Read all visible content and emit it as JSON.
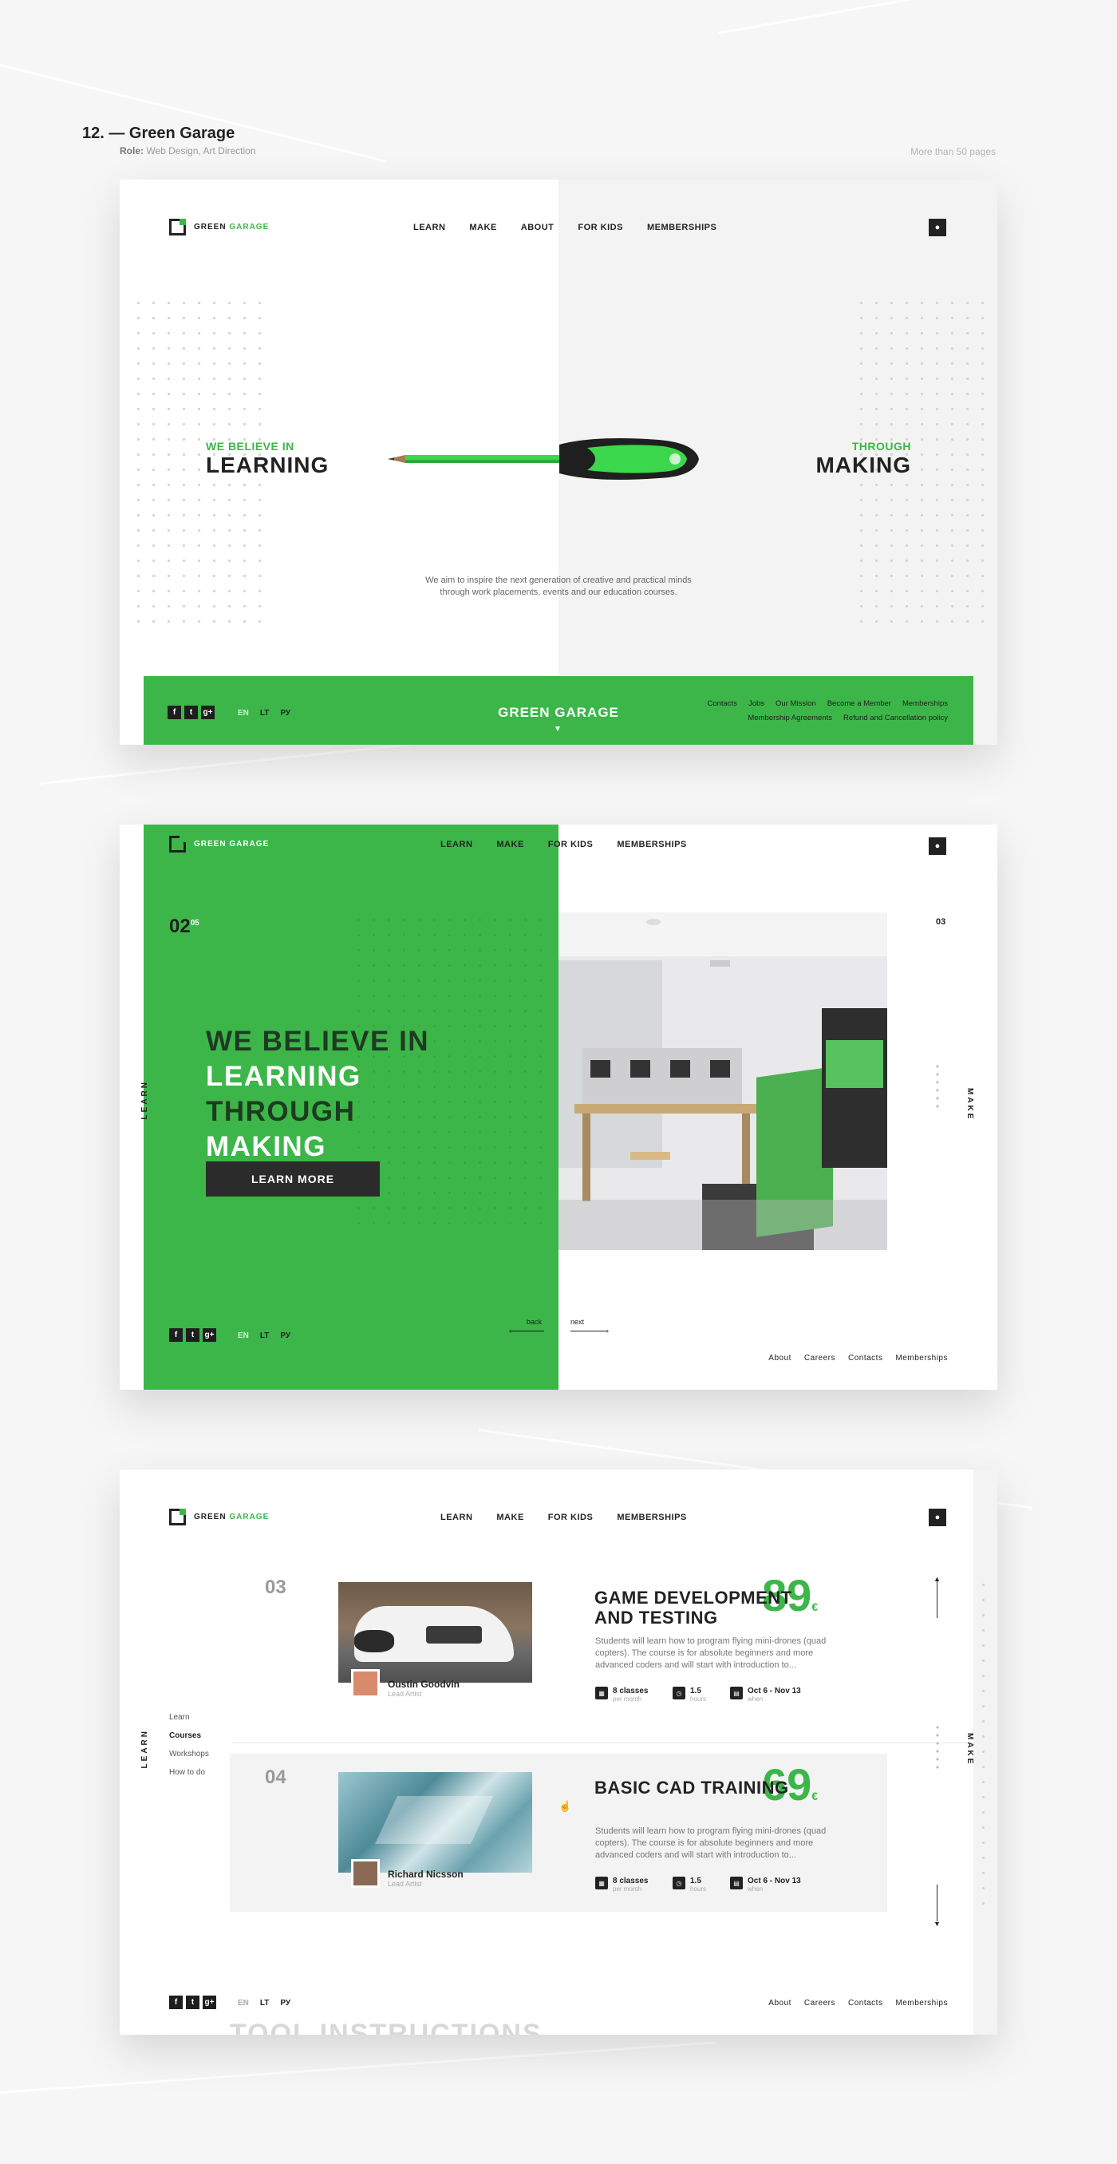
{
  "portfolio": {
    "title": "12. — Green Garage",
    "role_label": "Role:",
    "role_value": "Web Design, Art Direction",
    "pages_note": "More than 50 pages"
  },
  "brand": {
    "name_dark": "GREEN",
    "name_green": "GARAGE",
    "accent": "#3cb649",
    "dark": "#222222"
  },
  "screen1": {
    "nav": [
      "LEARN",
      "MAKE",
      "ABOUT",
      "FOR KIDS",
      "MEMBERSHIPS"
    ],
    "left_small": "WE BELIEVE IN",
    "left_big": "LEARNING",
    "right_small": "THROUGH",
    "right_big": "MAKING",
    "intro": "We aim to inspire the next generation of creative and practical minds through work placements, events and our education courses.",
    "footer_brand": "GREEN GARAGE",
    "langs": [
      "EN",
      "LT",
      "РУ"
    ],
    "social": [
      "f",
      "t",
      "g+"
    ],
    "links_row1": [
      "Contacts",
      "Jobs",
      "Our Mission",
      "Become a Member",
      "Memberships"
    ],
    "links_row2": [
      "Membership Agreements",
      "Refund and Cancellation policy"
    ]
  },
  "screen2": {
    "nav": [
      "LEARN",
      "MAKE",
      "FOR KIDS",
      "MEMBERSHIPS"
    ],
    "slide_num": "02",
    "slide_total": "05",
    "next_num": "03",
    "headline": [
      "WE BELIEVE IN",
      "LEARNING",
      "THROUGH",
      "MAKING"
    ],
    "button": "LEARN MORE",
    "side_left": "LEARN",
    "side_right": "MAKE",
    "back": "back",
    "next": "next",
    "langs": [
      "EN",
      "LT",
      "РУ"
    ],
    "social": [
      "f",
      "t",
      "g+"
    ],
    "footer_links": [
      "About",
      "Careers",
      "Contacts",
      "Memberships"
    ]
  },
  "screen3": {
    "nav": [
      "LEARN",
      "MAKE",
      "FOR KIDS",
      "MEMBERSHIPS"
    ],
    "side_menu": [
      "Learn",
      "Courses",
      "Workshops",
      "How to do"
    ],
    "side_left": "LEARN",
    "side_right": "MAKE",
    "courses": [
      {
        "num": "03",
        "title": "GAME DEVELOPMENT AND TESTING",
        "price": "89",
        "currency": "€",
        "desc": "Students will learn how to program flying mini-drones (quad copters). The course is for absolute beginners and more advanced coders and will start with introduction to...",
        "author": "Oustin Goodvin",
        "role": "Lead Artist",
        "classes": "8 classes",
        "classes_l": "per month",
        "hours": "1.5",
        "hours_l": "hours",
        "dates": "Oct 6 - Nov 13",
        "dates_l": "when"
      },
      {
        "num": "04",
        "title": "BASIC CAD TRAINING",
        "price": "69",
        "currency": "€",
        "desc": "Students will learn how to program flying mini-drones (quad copters). The course is for absolute beginners and more advanced coders and will start with introduction to...",
        "author": "Richard Nicsson",
        "role": "Lead Artist",
        "classes": "8 classes",
        "classes_l": "per month",
        "hours": "1.5",
        "hours_l": "hours",
        "dates": "Oct 6 - Nov 13",
        "dates_l": "when"
      }
    ],
    "bottom_text": "TOOL INSTRUCTIONS",
    "langs": [
      "EN",
      "LT",
      "РУ"
    ],
    "social": [
      "f",
      "t",
      "g+"
    ],
    "footer_links": [
      "About",
      "Careers",
      "Contacts",
      "Memberships"
    ]
  }
}
